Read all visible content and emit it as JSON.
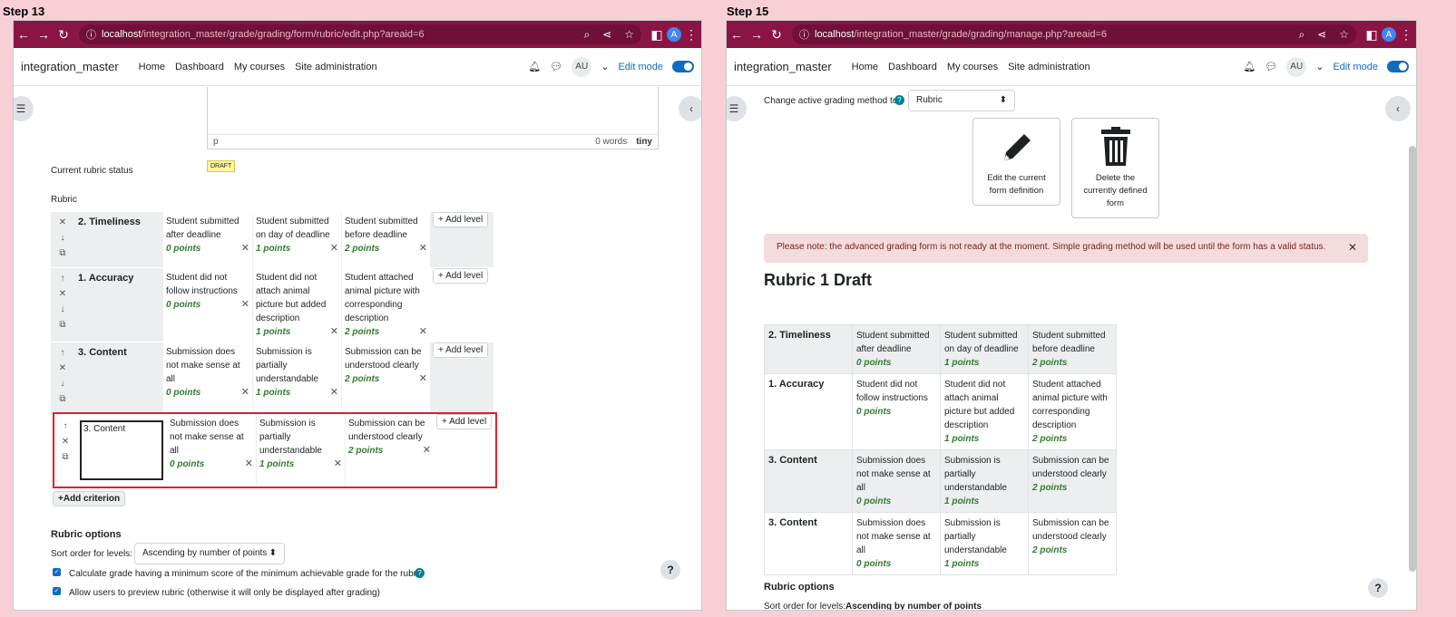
{
  "left": {
    "step_label": "Step 13",
    "url_host": "localhost",
    "url_path": "/integration_master/grade/grading/form/rubric/edit.php?areaid=6",
    "brand": "integration_master",
    "nav": [
      "Home",
      "Dashboard",
      "My courses",
      "Site administration"
    ],
    "user_initials": "AU",
    "edit_mode": "Edit mode",
    "editor_format": "p",
    "editor_words": "0 words",
    "editor_brand": "tiny",
    "status_label": "Current rubric status",
    "status_badge": "DRAFT",
    "rubric_label": "Rubric",
    "add_level": "+ Add level",
    "add_criterion": "+Add criterion",
    "criteria": [
      {
        "title": "2. Timeliness",
        "levels": [
          {
            "d": "Student submitted after deadline",
            "p": "0 points"
          },
          {
            "d": "Student submitted on day of deadline",
            "p": "1 points"
          },
          {
            "d": "Student submitted before deadline",
            "p": "2 points"
          }
        ]
      },
      {
        "title": "1. Accuracy",
        "levels": [
          {
            "d": "Student did not follow instructions",
            "p": "0 points"
          },
          {
            "d": "Student did not attach animal picture but added description",
            "p": "1 points"
          },
          {
            "d": "Student attached animal picture with corresponding description",
            "p": "2 points"
          }
        ]
      },
      {
        "title": "3. Content",
        "levels": [
          {
            "d": "Submission does not make sense at all",
            "p": "0 points"
          },
          {
            "d": "Submission is partially understandable",
            "p": "1 points"
          },
          {
            "d": "Submission can be understood clearly",
            "p": "2 points"
          }
        ]
      },
      {
        "title": "3. Content",
        "levels": [
          {
            "d": "Submission does not make sense at all",
            "p": "0 points"
          },
          {
            "d": "Submission is partially understandable",
            "p": "1 points"
          },
          {
            "d": "Submission can be understood clearly",
            "p": "2 points"
          }
        ]
      }
    ],
    "options_heading": "Rubric options",
    "sort_label": "Sort order for levels:",
    "sort_value": "Ascending by number of points",
    "opt1": "Calculate grade having a minimum score of the minimum achievable grade for the rubric",
    "opt2": "Allow users to preview rubric (otherwise it will only be displayed after grading)",
    "help": "?"
  },
  "right": {
    "step_label": "Step 15",
    "url_host": "localhost",
    "url_path": "/integration_master/grade/grading/manage.php?areaid=6",
    "brand": "integration_master",
    "nav": [
      "Home",
      "Dashboard",
      "My courses",
      "Site administration"
    ],
    "user_initials": "AU",
    "edit_mode": "Edit mode",
    "method_label": "Change active grading method to",
    "method_value": "Rubric",
    "edit_card": "Edit the current form definition",
    "delete_card": "Delete the currently defined form",
    "alert": "Please note: the advanced grading form is not ready at the moment. Simple grading method will be used until the form has a valid status.",
    "rubric_title": "Rubric 1 Draft",
    "criteria": [
      {
        "title": "2. Timeliness",
        "levels": [
          {
            "d": "Student submitted after deadline",
            "p": "0 points"
          },
          {
            "d": "Student submitted on day of deadline",
            "p": "1 points"
          },
          {
            "d": "Student submitted before deadline",
            "p": "2 points"
          }
        ]
      },
      {
        "title": "1. Accuracy",
        "levels": [
          {
            "d": "Student did not follow instructions",
            "p": "0 points"
          },
          {
            "d": "Student did not attach animal picture but added description",
            "p": "1 points"
          },
          {
            "d": "Student attached animal picture with corresponding description",
            "p": "2 points"
          }
        ]
      },
      {
        "title": "3. Content",
        "levels": [
          {
            "d": "Submission does not make sense at all",
            "p": "0 points"
          },
          {
            "d": "Submission is partially understandable",
            "p": "1 points"
          },
          {
            "d": "Submission can be understood clearly",
            "p": "2 points"
          }
        ]
      },
      {
        "title": "3. Content",
        "levels": [
          {
            "d": "Submission does not make sense at all",
            "p": "0 points"
          },
          {
            "d": "Submission is partially understandable",
            "p": "1 points"
          },
          {
            "d": "Submission can be understood clearly",
            "p": "2 points"
          }
        ]
      }
    ],
    "options_heading": "Rubric options",
    "sort_label": "Sort order for levels:",
    "sort_value": "Ascending by number of points",
    "help": "?"
  }
}
